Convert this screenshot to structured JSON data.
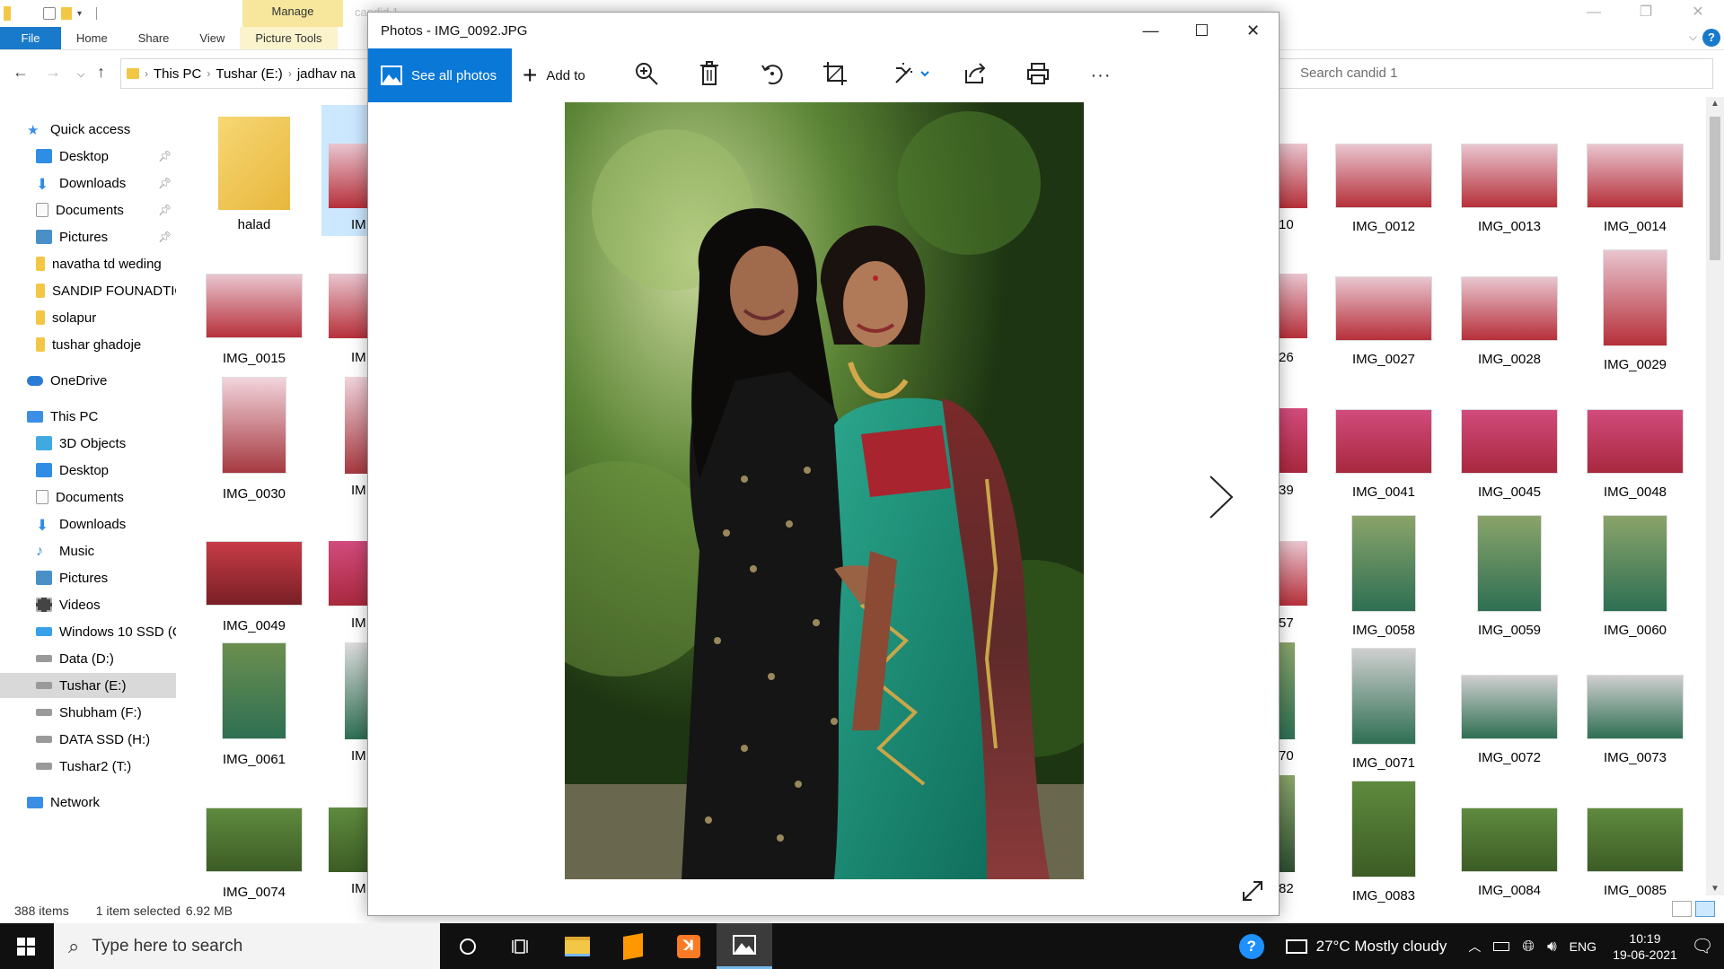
{
  "explorer": {
    "ribbon": {
      "context_tab": "Manage",
      "faded_title": "candid 1",
      "tabs": [
        "File",
        "Home",
        "Share",
        "View",
        "Picture Tools"
      ]
    },
    "address": {
      "crumbs": [
        "This PC",
        "Tushar (E:)",
        "jadhav na"
      ],
      "search_placeholder": "Search candid 1"
    },
    "nav": {
      "quick_access": "Quick access",
      "quick_items": [
        "Desktop",
        "Downloads",
        "Documents",
        "Pictures",
        "navatha td weding",
        "SANDIP FOUNADTIO",
        "solapur",
        "tushar ghadoje"
      ],
      "onedrive": "OneDrive",
      "this_pc": "This PC",
      "pc_items": [
        "3D Objects",
        "Desktop",
        "Documents",
        "Downloads",
        "Music",
        "Pictures",
        "Videos",
        "Windows 10 SSD (C",
        "Data (D:)",
        "Tushar (E:)",
        "Shubham (F:)",
        "DATA SSD (H:)",
        "Tushar2 (T:)"
      ],
      "network": "Network"
    },
    "files_left": [
      [
        "halad",
        "IM"
      ],
      [
        "IMG_0015",
        "IM"
      ],
      [
        "IMG_0030",
        "IM"
      ],
      [
        "IMG_0049",
        "IM"
      ],
      [
        "IMG_0061",
        "IM"
      ],
      [
        "IMG_0074",
        "IM"
      ]
    ],
    "files_right_partial": [
      "10",
      "26",
      "39",
      "57",
      "70",
      "82"
    ],
    "files_right": [
      [
        "IMG_0012",
        "IMG_0013",
        "IMG_0014"
      ],
      [
        "IMG_0027",
        "IMG_0028",
        "IMG_0029"
      ],
      [
        "IMG_0041",
        "IMG_0045",
        "IMG_0048"
      ],
      [
        "IMG_0058",
        "IMG_0059",
        "IMG_0060"
      ],
      [
        "IMG_0071",
        "IMG_0072",
        "IMG_0073"
      ],
      [
        "IMG_0083",
        "IMG_0084",
        "IMG_0085"
      ]
    ],
    "status": {
      "items": "388 items",
      "selected": "1 item selected",
      "size": "6.92 MB"
    }
  },
  "photos": {
    "title": "Photos - IMG_0092.JPG",
    "see_all": "See all photos",
    "add_to": "Add to"
  },
  "taskbar": {
    "search_placeholder": "Type here to search",
    "weather": "27°C  Mostly cloudy",
    "lang": "ENG",
    "time": "10:19",
    "date": "19-06-2021"
  },
  "colors": {
    "accent": "#0a78d7",
    "file_tab": "#1979ca",
    "manage_tab": "#f6e79d",
    "taskbar": "#101010"
  }
}
